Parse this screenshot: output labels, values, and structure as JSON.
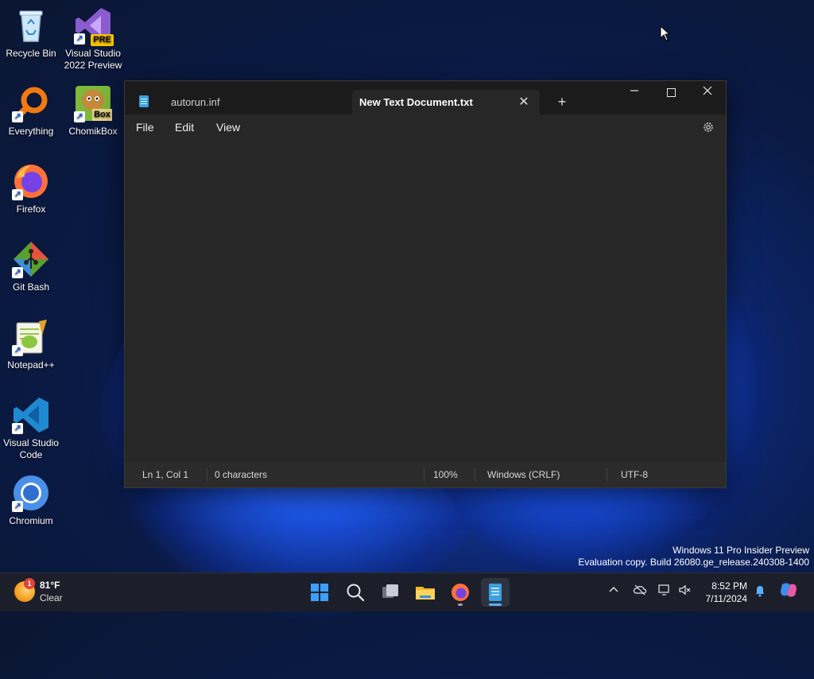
{
  "desktop": {
    "icons": [
      {
        "label": "Recycle Bin"
      },
      {
        "label": "Visual Studio 2022 Preview",
        "badge": "PRE"
      },
      {
        "label": "Everything"
      },
      {
        "label": "ChomikBox",
        "badge": "Box"
      },
      {
        "label": "Firefox"
      },
      {
        "label": "Git Bash"
      },
      {
        "label": "Notepad++"
      },
      {
        "label": "Visual Studio Code"
      },
      {
        "label": "Chromium"
      }
    ]
  },
  "window": {
    "tabs": [
      {
        "label": "autorun.inf",
        "active": false
      },
      {
        "label": "New Text Document.txt",
        "active": true
      }
    ],
    "close_tab_glyph": "✕",
    "new_tab_glyph": "+",
    "menu": {
      "file": "File",
      "edit": "Edit",
      "view": "View"
    },
    "settings_icon": "gear-icon",
    "status": {
      "position": "Ln 1, Col 1",
      "characters": "0 characters",
      "zoom": "100%",
      "line_ending": "Windows (CRLF)",
      "encoding": "UTF-8"
    }
  },
  "watermark": {
    "line1": "Windows 11 Pro Insider Preview",
    "line2": "Evaluation copy. Build 26080.ge_release.240308-1400"
  },
  "taskbar": {
    "weather": {
      "badge": "1",
      "temp": "81°F",
      "condition": "Clear"
    },
    "clock": {
      "time": "8:52 PM",
      "date": "7/11/2024"
    }
  },
  "colors": {
    "accent": "#5ab0ff",
    "window_bg": "#202020",
    "editor_bg": "#272727"
  }
}
